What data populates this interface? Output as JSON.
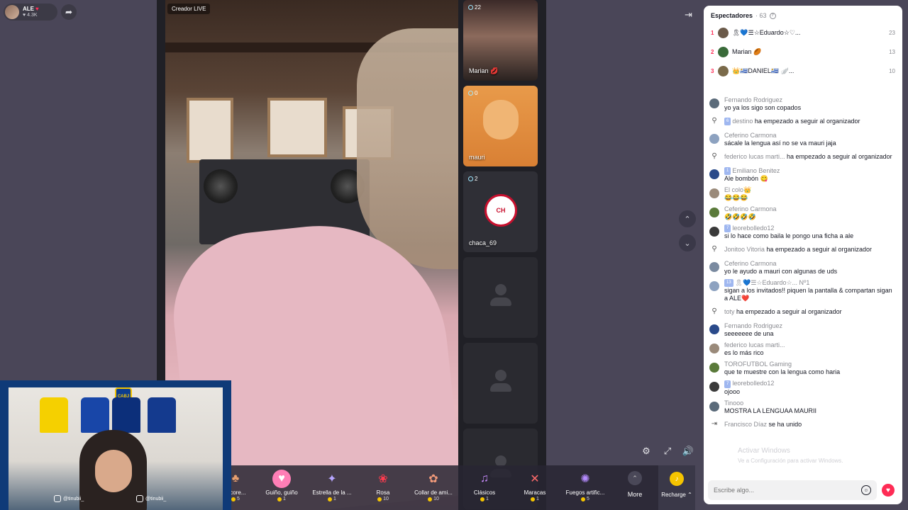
{
  "host": {
    "name": "ALE",
    "likes": "4.3K"
  },
  "stage": {
    "creator_label": "Creador LIVE"
  },
  "guests": [
    {
      "count": "22",
      "name": "Marian 💋"
    },
    {
      "count": "0",
      "name": "mauri"
    },
    {
      "count": "2",
      "name": "chaca_69",
      "logo_text": "CH"
    }
  ],
  "gifts": [
    {
      "name": "n core...",
      "price": "5"
    },
    {
      "name": "Guiño, guiño",
      "price": "1"
    },
    {
      "name": "Estrella de la ...",
      "price": "1"
    },
    {
      "name": "Rosa",
      "price": "10"
    },
    {
      "name": "Collar de ami...",
      "price": "10"
    },
    {
      "name": "Clásicos",
      "price": "1"
    },
    {
      "name": "Maracas",
      "price": "1"
    },
    {
      "name": "Fuegos artific...",
      "price": "5"
    }
  ],
  "gift_bar": {
    "more_label": "More",
    "recharge_label": "Recharge ⌃"
  },
  "webcam": {
    "handle_1": "@tinubii_",
    "handle_2": "@tinubii_",
    "club_badge": "CABJ"
  },
  "panel": {
    "title": "Espectadores",
    "count": "· 63",
    "ranks": [
      {
        "num": "1",
        "name": "🎗💙☰☆Eduardo☆♡...",
        "score": "23"
      },
      {
        "num": "2",
        "name": "Marian 🏉",
        "score": "13"
      },
      {
        "num": "3",
        "name": "👑🇺🇾DANIEL🇺🇾 🪽...",
        "score": "10"
      }
    ],
    "messages": [
      {
        "type": "chat",
        "level": "",
        "user": "Fernando Rodriguez",
        "text": "yo ya los sigo son copados"
      },
      {
        "type": "follow",
        "level": "6",
        "user": "destino",
        "text": "ha empezado a seguir al organizador"
      },
      {
        "type": "chat",
        "level": "",
        "user": "Ceferino Carmona",
        "text": "sácale la lengua así no se va mauri jaja"
      },
      {
        "type": "follow",
        "level": "",
        "user": "federico lucas marti...",
        "text": "ha empezado a seguir al organizador"
      },
      {
        "type": "chat",
        "level": "1",
        "user": "Emiliano Benitez",
        "text": "Ale bombón 😋"
      },
      {
        "type": "chat",
        "level": "",
        "user": "El colo👑",
        "text": "😂😂😂"
      },
      {
        "type": "chat",
        "level": "",
        "user": "Ceferino Carmona",
        "text": "🤣🤣🤣🤣"
      },
      {
        "type": "chat",
        "level": "7",
        "user": "leorebolledo12",
        "text": "si lo hace como baila le pongo una ficha a ale"
      },
      {
        "type": "follow",
        "level": "",
        "user": "Jonitoo Vitoria",
        "text": "ha empezado a seguir al organizador"
      },
      {
        "type": "chat",
        "level": "",
        "user": "Ceferino Carmona",
        "text": "yo le ayudo a mauri con algunas de uds"
      },
      {
        "type": "chat",
        "level": "13",
        "user": "🎗💙☰☆Eduardo☆... Nº1",
        "text": "sigan a los invitados!! piquen la pantalla & compartan sigan a ALE❤️"
      },
      {
        "type": "follow",
        "level": "",
        "user": "toty",
        "text": "ha empezado a seguir al organizador"
      },
      {
        "type": "chat",
        "level": "",
        "user": "Fernando Rodriguez",
        "text": "seeeeeee de una"
      },
      {
        "type": "chat",
        "level": "",
        "user": "federico lucas marti...",
        "text": "es lo más rico"
      },
      {
        "type": "chat",
        "level": "",
        "user": "TOROFUTBOL Gaming",
        "text": "que te muestre con la lengua como haria"
      },
      {
        "type": "chat",
        "level": "7",
        "user": "leorebolledo12",
        "text": "ojooo"
      },
      {
        "type": "chat",
        "level": "",
        "user": "Tinooo",
        "text": "MOSTRA LA LENGUAA MAURII"
      },
      {
        "type": "join",
        "level": "",
        "user": "Francisco Díaz",
        "text": "se ha unido"
      }
    ],
    "watermark_line1": "Activar Windows",
    "watermark_line2": "Ve a Configuración para activar Windows.",
    "input_placeholder": "Escribe algo..."
  }
}
